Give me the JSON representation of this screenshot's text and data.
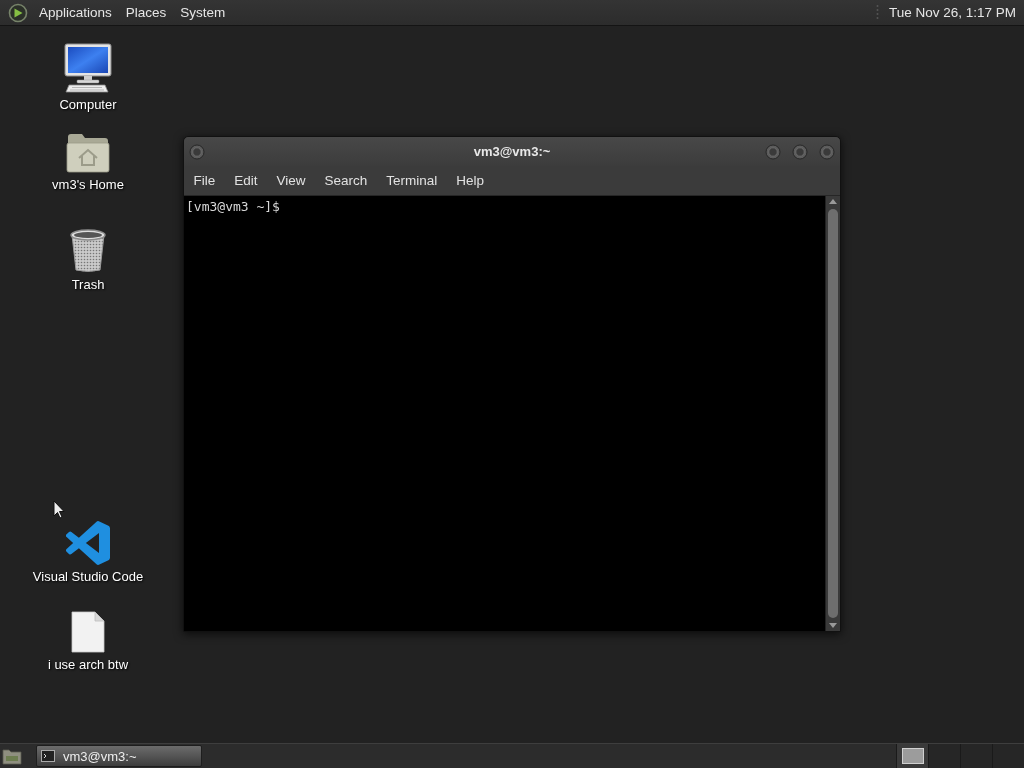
{
  "top_panel": {
    "menus": [
      "Applications",
      "Places",
      "System"
    ],
    "clock": "Tue Nov 26, 1:17 PM"
  },
  "desktop_icons": [
    {
      "kind": "computer",
      "label": "Computer"
    },
    {
      "kind": "home",
      "label": "vm3's Home"
    },
    {
      "kind": "trash",
      "label": "Trash"
    },
    {
      "kind": "code",
      "label": "Visual Studio Code"
    },
    {
      "kind": "file",
      "label": "i use arch btw"
    }
  ],
  "terminal_window": {
    "title": "vm3@vm3:~",
    "menus": [
      "File",
      "Edit",
      "View",
      "Search",
      "Terminal",
      "Help"
    ],
    "prompt": "[vm3@vm3 ~]$"
  },
  "bottom_panel": {
    "tasks": [
      {
        "label": "vm3@vm3:~",
        "selected": true
      }
    ],
    "workspaces": [
      {
        "selected": true
      },
      {
        "selected": false
      },
      {
        "selected": false
      },
      {
        "selected": false
      }
    ]
  }
}
